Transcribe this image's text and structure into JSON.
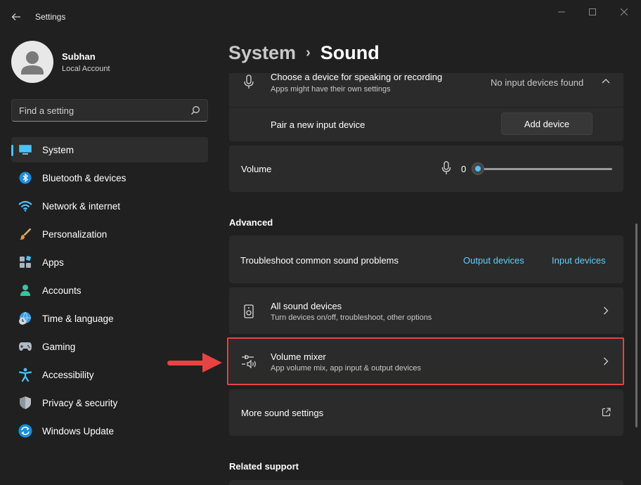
{
  "window": {
    "title": "Settings"
  },
  "user": {
    "name": "Subhan",
    "account_type": "Local Account"
  },
  "search": {
    "placeholder": "Find a setting"
  },
  "nav": {
    "items": [
      {
        "label": "System"
      },
      {
        "label": "Bluetooth & devices"
      },
      {
        "label": "Network & internet"
      },
      {
        "label": "Personalization"
      },
      {
        "label": "Apps"
      },
      {
        "label": "Accounts"
      },
      {
        "label": "Time & language"
      },
      {
        "label": "Gaming"
      },
      {
        "label": "Accessibility"
      },
      {
        "label": "Privacy & security"
      },
      {
        "label": "Windows Update"
      }
    ]
  },
  "breadcrumb": {
    "parent": "System",
    "separator": "›",
    "current": "Sound"
  },
  "input": {
    "choose_title": "Choose a device for speaking or recording",
    "choose_sub": "Apps might have their own settings",
    "choose_value": "No input devices found",
    "pair_label": "Pair a new input device",
    "add_device_label": "Add device"
  },
  "volume": {
    "label": "Volume",
    "value": "0",
    "level": 0
  },
  "advanced": {
    "heading": "Advanced",
    "troubleshoot_label": "Troubleshoot common sound problems",
    "output_link": "Output devices",
    "input_link": "Input devices",
    "all_devices_title": "All sound devices",
    "all_devices_sub": "Turn devices on/off, troubleshoot, other options",
    "mixer_title": "Volume mixer",
    "mixer_sub": "App volume mix, app input & output devices",
    "more_label": "More sound settings"
  },
  "related": {
    "heading": "Related support"
  },
  "colors": {
    "accent": "#4cc2ff",
    "link": "#60cdff",
    "highlight": "#e84343"
  }
}
